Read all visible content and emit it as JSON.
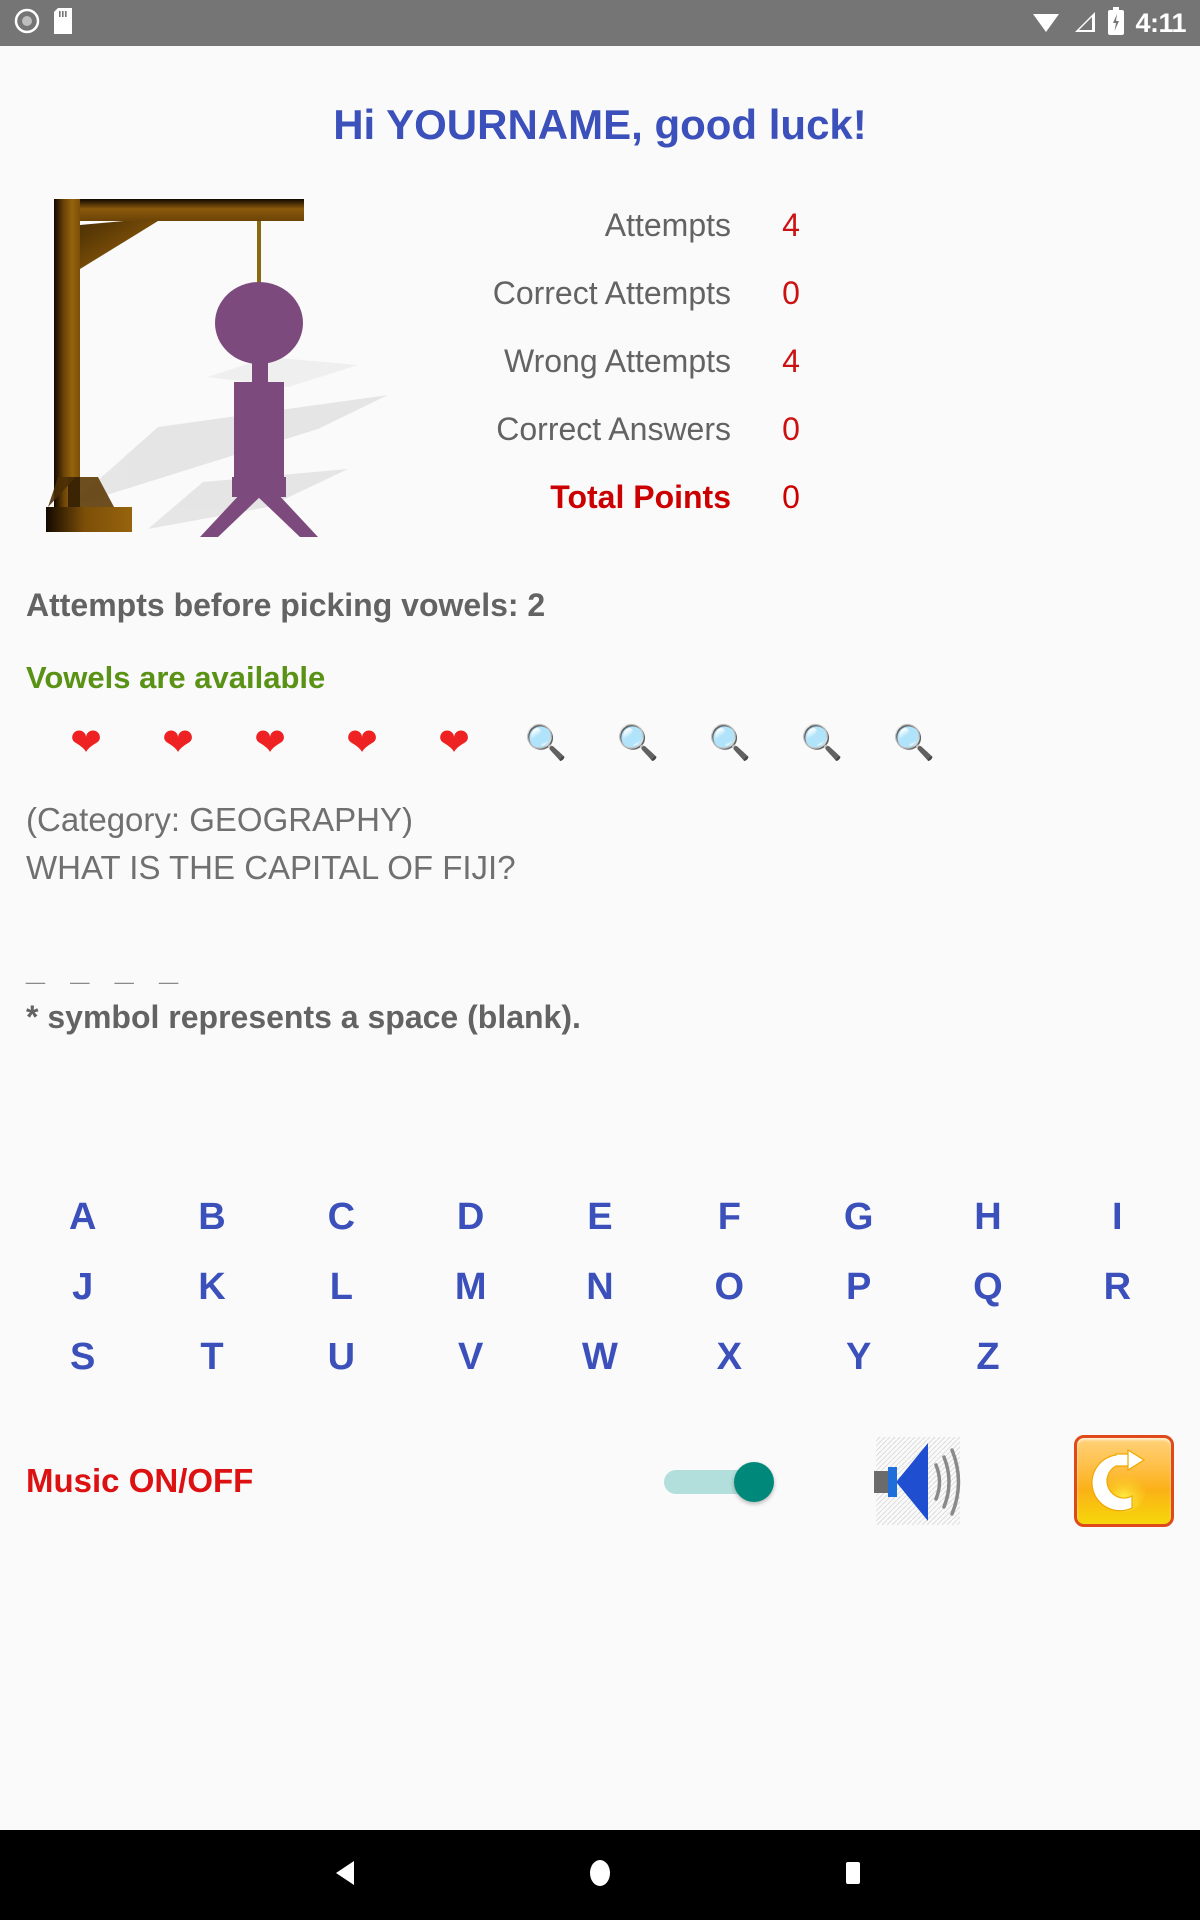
{
  "status_bar": {
    "icons_left": [
      "record-circle-icon",
      "sd-card-icon"
    ],
    "icons_right": [
      "wifi-icon",
      "cell-signal-icon",
      "battery-charging-icon"
    ],
    "time": "4:11"
  },
  "header": {
    "greeting": "Hi YOURNAME, good luck!",
    "greeting_color": "#3b50ba"
  },
  "hangman": {
    "icon": "hangman-gallows-figure",
    "gallows_color": "#8a5a10",
    "figure_color": "#7d4a7d",
    "parts_shown": [
      "gallows",
      "rope",
      "head",
      "body",
      "legs"
    ]
  },
  "stats": {
    "rows": [
      {
        "label": "Attempts",
        "value": "4"
      },
      {
        "label": "Correct Attempts",
        "value": "0"
      },
      {
        "label": "Wrong Attempts",
        "value": "4"
      },
      {
        "label": "Correct Answers",
        "value": "0"
      },
      {
        "label": "Total Points",
        "value": "0"
      }
    ],
    "value_color": "#cc1111",
    "total_color": "#cc0000"
  },
  "info": {
    "vowel_count_text": "Attempts before picking vowels: 2",
    "vowel_status_text": "Vowels are available",
    "vowel_status_color": "#5a9216"
  },
  "lives": {
    "hearts": 5,
    "hints": 5,
    "heart_icon": "heart-icon",
    "hint_icon": "magnifying-glass-icon",
    "items": [
      {
        "type": "heart",
        "glyph": "❤"
      },
      {
        "type": "heart",
        "glyph": "❤"
      },
      {
        "type": "heart",
        "glyph": "❤"
      },
      {
        "type": "heart",
        "glyph": "❤"
      },
      {
        "type": "heart",
        "glyph": "❤"
      },
      {
        "type": "glass",
        "glyph": "🔍"
      },
      {
        "type": "glass",
        "glyph": "🔍"
      },
      {
        "type": "glass",
        "glyph": "🔍"
      },
      {
        "type": "glass",
        "glyph": "🔍"
      },
      {
        "type": "glass",
        "glyph": "🔍"
      }
    ]
  },
  "puzzle": {
    "category_line": "(Category: GEOGRAPHY)",
    "question": "WHAT IS THE CAPITAL OF FIJI?",
    "answer_blanks": "_ _ _ _",
    "blank_note": "* symbol represents a space (blank)."
  },
  "keyboard": {
    "rows": [
      [
        "A",
        "B",
        "C",
        "D",
        "E",
        "F",
        "G",
        "H",
        "I"
      ],
      [
        "J",
        "K",
        "L",
        "M",
        "N",
        "O",
        "P",
        "Q",
        "R"
      ],
      [
        "S",
        "T",
        "U",
        "V",
        "W",
        "X",
        "Y",
        "Z",
        ""
      ]
    ]
  },
  "controls": {
    "music_label": "Music ON/OFF",
    "music_label_color": "#dd1111",
    "toggle_state": "on",
    "speaker_icon": "speaker-volume-icon",
    "refresh_icon": "refresh-restart-icon"
  },
  "nav_bar": {
    "back_icon": "back-triangle-icon",
    "home_icon": "home-circle-icon",
    "recents_icon": "recents-square-icon"
  }
}
